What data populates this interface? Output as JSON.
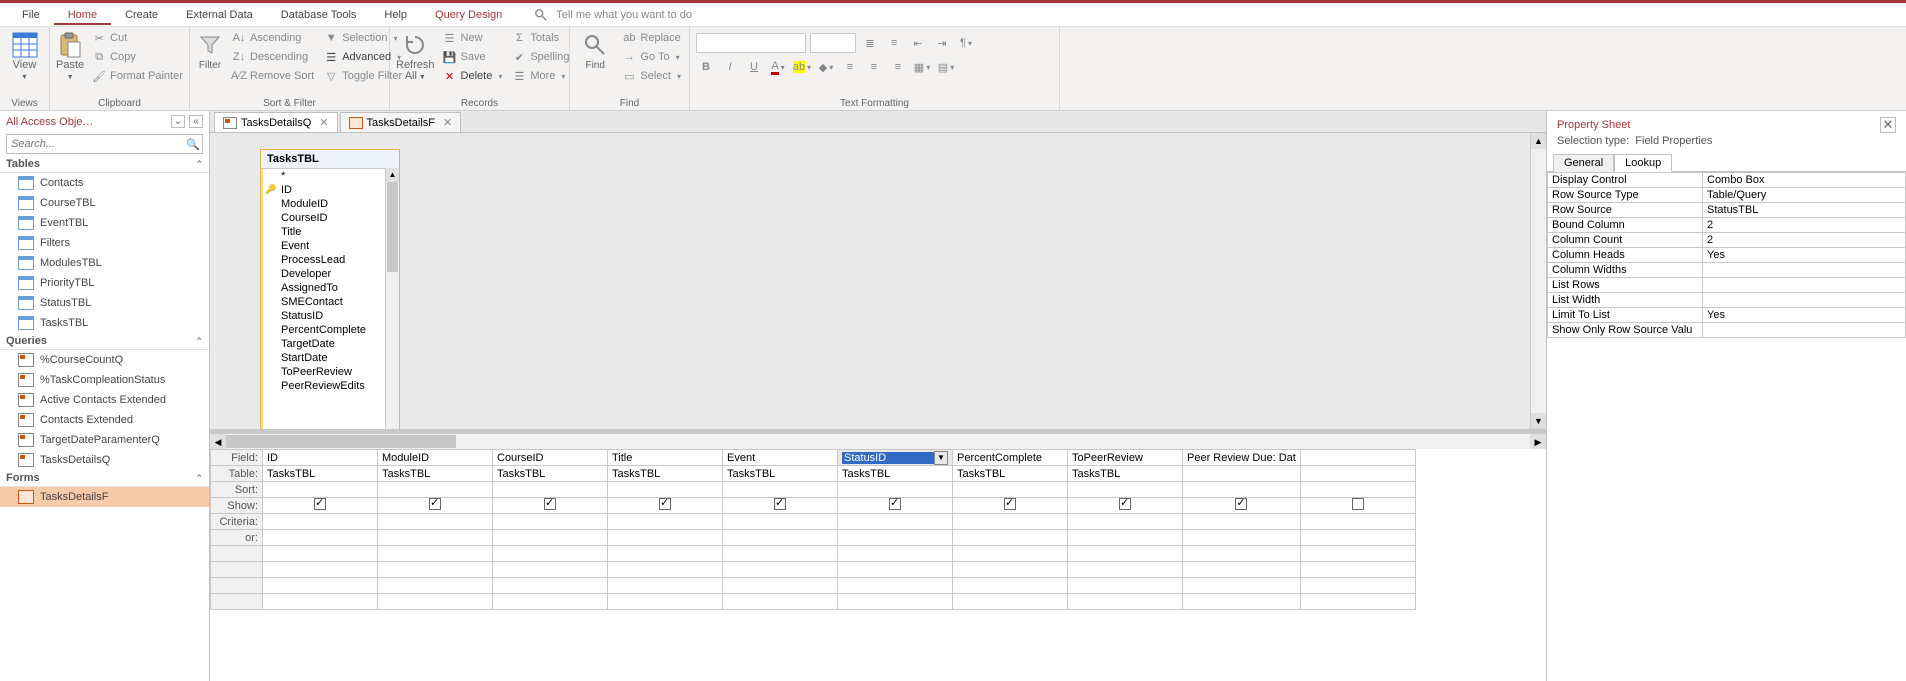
{
  "menu": {
    "file": "File",
    "home": "Home",
    "create": "Create",
    "extdata": "External Data",
    "dbtools": "Database Tools",
    "help": "Help",
    "qdesign": "Query Design",
    "tellme": "Tell me what you want to do"
  },
  "ribbon": {
    "views": {
      "label": "Views",
      "view": "View"
    },
    "clipboard": {
      "label": "Clipboard",
      "paste": "Paste",
      "cut": "Cut",
      "copy": "Copy",
      "fmtp": "Format Painter"
    },
    "sortfilter": {
      "label": "Sort & Filter",
      "filter": "Filter",
      "asc": "Ascending",
      "desc": "Descending",
      "remsort": "Remove Sort",
      "sel": "Selection",
      "adv": "Advanced",
      "togf": "Toggle Filter"
    },
    "records": {
      "label": "Records",
      "refresh": "Refresh All",
      "new": "New",
      "save": "Save",
      "del": "Delete",
      "totals": "Totals",
      "spell": "Spelling",
      "more": "More"
    },
    "find": {
      "label": "Find",
      "find": "Find",
      "replace": "Replace",
      "goto": "Go To",
      "select": "Select"
    },
    "textfmt": {
      "label": "Text Formatting"
    }
  },
  "nav": {
    "title": "All Access Obje…",
    "search_ph": "Search...",
    "groups": [
      {
        "label": "Tables",
        "type": "t",
        "items": [
          "Contacts",
          "CourseTBL",
          "EventTBL",
          "Filters",
          "ModulesTBL",
          "PriorityTBL",
          "StatusTBL",
          "TasksTBL"
        ]
      },
      {
        "label": "Queries",
        "type": "q",
        "items": [
          "%CourseCountQ",
          "%TaskCompleationStatus",
          "Active Contacts Extended",
          "Contacts Extended",
          "TargetDateParamenterQ",
          "TasksDetailsQ"
        ]
      },
      {
        "label": "Forms",
        "type": "f",
        "items": [
          "TasksDetailsF"
        ],
        "sel": 0
      }
    ]
  },
  "tabs": [
    {
      "label": "TasksDetailsQ",
      "type": "q",
      "active": true
    },
    {
      "label": "TasksDetailsF",
      "type": "f",
      "active": false
    }
  ],
  "fieldbox": {
    "title": "TasksTBL",
    "fields": [
      "*",
      "ID",
      "ModuleID",
      "CourseID",
      "Title",
      "Event",
      "ProcessLead",
      "Developer",
      "AssignedTo",
      "SMEContact",
      "StatusID",
      "PercentComplete",
      "TargetDate",
      "StartDate",
      "ToPeerReview",
      "PeerReviewEdits"
    ]
  },
  "grid": {
    "rowlabels": [
      "Field:",
      "Table:",
      "Sort:",
      "Show:",
      "Criteria:",
      "or:"
    ],
    "cols": [
      {
        "field": "ID",
        "table": "TasksTBL",
        "show": true
      },
      {
        "field": "ModuleID",
        "table": "TasksTBL",
        "show": true
      },
      {
        "field": "CourseID",
        "table": "TasksTBL",
        "show": true
      },
      {
        "field": "Title",
        "table": "TasksTBL",
        "show": true
      },
      {
        "field": "Event",
        "table": "TasksTBL",
        "show": true
      },
      {
        "field": "StatusID",
        "table": "TasksTBL",
        "show": true,
        "sel": true
      },
      {
        "field": "PercentComplete",
        "table": "TasksTBL",
        "show": true
      },
      {
        "field": "ToPeerReview",
        "table": "TasksTBL",
        "show": true
      },
      {
        "field": "Peer Review Due: Dat",
        "table": "",
        "show": true
      },
      {
        "field": "",
        "table": "",
        "show": false
      }
    ]
  },
  "prop": {
    "title": "Property Sheet",
    "seltype_l": "Selection type:",
    "seltype_v": "Field Properties",
    "tabs": [
      "General",
      "Lookup"
    ],
    "rows": [
      [
        "Display Control",
        "Combo Box"
      ],
      [
        "Row Source Type",
        "Table/Query"
      ],
      [
        "Row Source",
        "StatusTBL"
      ],
      [
        "Bound Column",
        "2"
      ],
      [
        "Column Count",
        "2"
      ],
      [
        "Column Heads",
        "Yes"
      ],
      [
        "Column Widths",
        ""
      ],
      [
        "List Rows",
        ""
      ],
      [
        "List Width",
        ""
      ],
      [
        "Limit To List",
        "Yes"
      ],
      [
        "Show Only Row Source Valu",
        ""
      ]
    ]
  }
}
